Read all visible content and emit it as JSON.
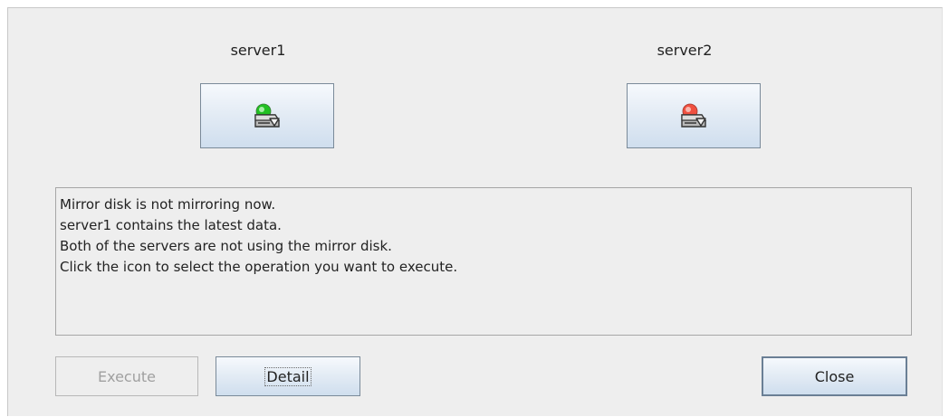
{
  "servers": [
    {
      "name": "server1",
      "status_color": "#22c022",
      "icon": "mirror-disk-server-icon"
    },
    {
      "name": "server2",
      "status_color": "#f05040",
      "icon": "mirror-disk-server-icon"
    }
  ],
  "message": {
    "lines": [
      "Mirror disk is not mirroring now.",
      "server1 contains the latest data.",
      "Both of the servers are not using the mirror disk.",
      "Click the icon to select the operation you want to execute."
    ]
  },
  "buttons": {
    "execute": "Execute",
    "detail": "Detail",
    "close": "Close"
  }
}
